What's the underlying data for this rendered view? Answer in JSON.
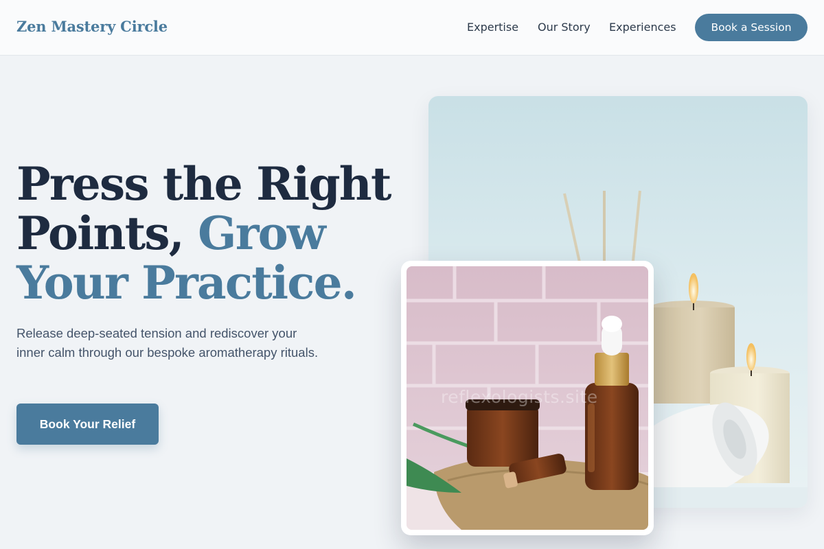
{
  "header": {
    "brand": "Zen Mastery Circle",
    "nav": [
      "Expertise",
      "Our Story",
      "Experiences"
    ],
    "cta_label": "Book a Session"
  },
  "hero": {
    "headline_line1": "Press the Right",
    "headline_line2_a": "Points, ",
    "headline_line2_b": "Grow",
    "headline_line3": "Your Practice.",
    "lede": "Release deep-seated tension and rediscover your inner calm through our bespoke aromatherapy rituals.",
    "cta_label": "Book Your Relief"
  },
  "media": {
    "main_image": "candles-towel-reed-diffuser",
    "card_image": "amber-dropper-bottles",
    "watermark": "reflexologists.site"
  },
  "colors": {
    "accent": "#4a7b9d",
    "heading": "#1e2b40",
    "background": "#f0f3f6"
  }
}
